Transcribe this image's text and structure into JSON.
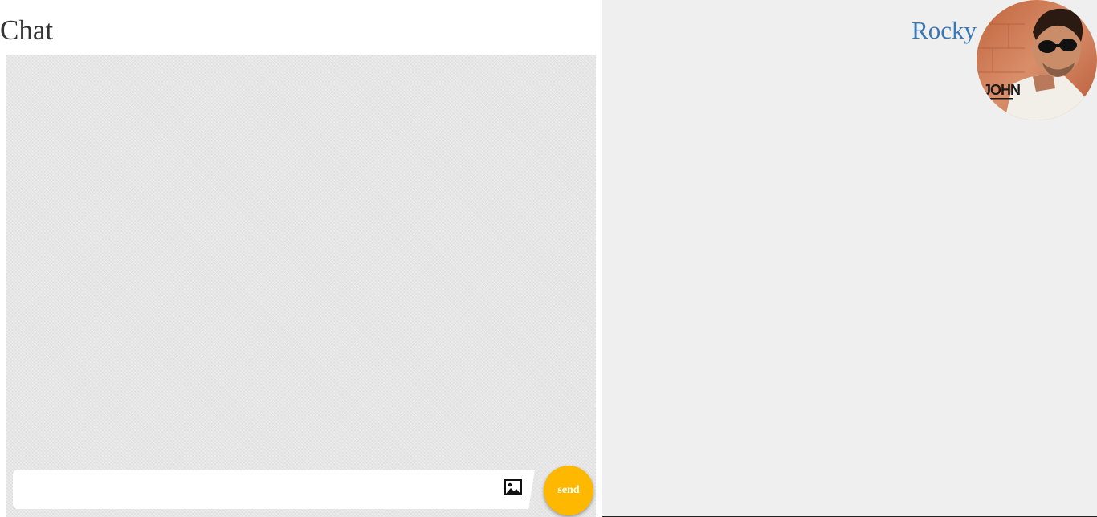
{
  "chat": {
    "title": "Chat",
    "input_value": "",
    "input_placeholder": "",
    "image_icon": "image-icon",
    "send_label": "send"
  },
  "user": {
    "name": "Rocky",
    "avatar_text": "JOHN"
  },
  "colors": {
    "send_button": "#ffb800",
    "user_name": "#3a78b5",
    "right_panel_bg": "#efefef",
    "chat_area_bg": "#e6e6e6"
  }
}
